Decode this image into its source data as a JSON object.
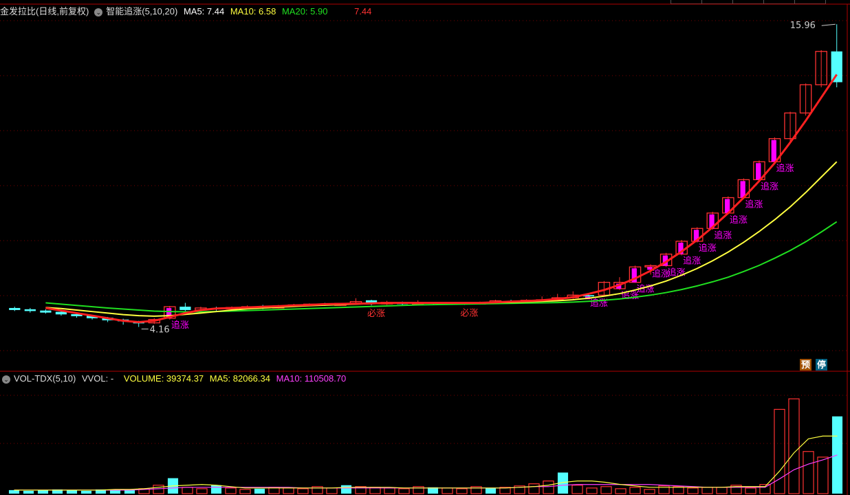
{
  "header_main": {
    "title": "金发拉比(日线,前复权)",
    "indicator": "智能追涨(5,10,20)",
    "ma5": "MA5: 7.44",
    "ma10": "MA10: 6.58",
    "ma20": "MA20: 5.90",
    "extra": "7.44"
  },
  "header_volume": {
    "indicator": "VOL-TDX(5,10)",
    "vvol": "VVOL: -",
    "volume": "VOLUME: 39374.37",
    "ma5": "MA5: 82066.34",
    "ma10": "MA10: 110508.70"
  },
  "annotations": {
    "high_label": "15.96",
    "low_label": "4.16",
    "signal_up": "追涨",
    "signal_must": "必涨"
  },
  "badges": {
    "pre": "预",
    "stop": "停"
  },
  "colors": {
    "ma5": "#ff2020",
    "ma10": "#ffff40",
    "ma20": "#20e020",
    "up": "#ff3232",
    "down": "#54ffff",
    "signal": "#ff00ff",
    "grid": "#7a0000",
    "vol_ma5": "#ffff40",
    "vol_ma10": "#ff40ff"
  },
  "chart_data": {
    "type": "candlestick",
    "price_range": [
      4.16,
      15.96
    ],
    "candles": [
      {
        "o": 4.9,
        "c": 4.82,
        "h": 4.95,
        "l": 4.78
      },
      {
        "o": 4.85,
        "c": 4.78,
        "h": 4.9,
        "l": 4.72
      },
      {
        "o": 4.8,
        "c": 4.72,
        "h": 4.85,
        "l": 4.68
      },
      {
        "o": 4.75,
        "c": 4.65,
        "h": 4.78,
        "l": 4.6
      },
      {
        "o": 4.66,
        "c": 4.58,
        "h": 4.7,
        "l": 4.52
      },
      {
        "o": 4.6,
        "c": 4.5,
        "h": 4.62,
        "l": 4.45
      },
      {
        "o": 4.52,
        "c": 4.42,
        "h": 4.55,
        "l": 4.35
      },
      {
        "o": 4.45,
        "c": 4.38,
        "h": 4.48,
        "l": 4.25
      },
      {
        "o": 4.35,
        "c": 4.3,
        "h": 4.4,
        "l": 4.16
      },
      {
        "o": 4.32,
        "c": 4.45,
        "h": 4.5,
        "l": 4.28
      },
      {
        "o": 4.5,
        "c": 4.95,
        "h": 4.98,
        "l": 4.45
      },
      {
        "o": 4.95,
        "c": 4.82,
        "h": 5.1,
        "l": 4.78
      },
      {
        "o": 4.82,
        "c": 4.9,
        "h": 4.95,
        "l": 4.8
      },
      {
        "o": 4.9,
        "c": 4.85,
        "h": 4.95,
        "l": 4.8
      },
      {
        "o": 4.86,
        "c": 4.92,
        "h": 4.96,
        "l": 4.84
      },
      {
        "o": 4.9,
        "c": 4.95,
        "h": 5.0,
        "l": 4.85
      },
      {
        "o": 4.95,
        "c": 4.9,
        "h": 5.02,
        "l": 4.86
      },
      {
        "o": 4.9,
        "c": 4.98,
        "h": 5.02,
        "l": 4.88
      },
      {
        "o": 4.98,
        "c": 5.02,
        "h": 5.06,
        "l": 4.95
      },
      {
        "o": 5.0,
        "c": 5.05,
        "h": 5.08,
        "l": 4.97
      },
      {
        "o": 5.05,
        "c": 5.0,
        "h": 5.1,
        "l": 4.98
      },
      {
        "o": 5.0,
        "c": 5.08,
        "h": 5.1,
        "l": 4.98
      },
      {
        "o": 5.08,
        "c": 5.15,
        "h": 5.28,
        "l": 5.05
      },
      {
        "o": 5.2,
        "c": 5.05,
        "h": 5.22,
        "l": 5.0
      },
      {
        "o": 5.06,
        "c": 5.12,
        "h": 5.18,
        "l": 5.02
      },
      {
        "o": 5.12,
        "c": 5.05,
        "h": 5.15,
        "l": 5.0
      },
      {
        "o": 5.05,
        "c": 5.1,
        "h": 5.2,
        "l": 5.02
      },
      {
        "o": 5.1,
        "c": 5.08,
        "h": 5.12,
        "l": 5.03
      },
      {
        "o": 5.08,
        "c": 5.1,
        "h": 5.14,
        "l": 5.05
      },
      {
        "o": 5.1,
        "c": 5.05,
        "h": 5.13,
        "l": 5.02
      },
      {
        "o": 5.05,
        "c": 5.12,
        "h": 5.15,
        "l": 5.03
      },
      {
        "o": 5.12,
        "c": 5.18,
        "h": 5.22,
        "l": 5.1
      },
      {
        "o": 5.18,
        "c": 5.16,
        "h": 5.22,
        "l": 5.12
      },
      {
        "o": 5.16,
        "c": 5.2,
        "h": 5.24,
        "l": 5.14
      },
      {
        "o": 5.2,
        "c": 5.22,
        "h": 5.35,
        "l": 5.16
      },
      {
        "o": 5.22,
        "c": 5.3,
        "h": 5.45,
        "l": 5.18
      },
      {
        "o": 5.3,
        "c": 5.4,
        "h": 5.55,
        "l": 5.25
      },
      {
        "o": 5.4,
        "c": 5.35,
        "h": 5.48,
        "l": 5.3
      },
      {
        "o": 5.4,
        "c": 5.9,
        "h": 5.95,
        "l": 5.38
      },
      {
        "o": 5.65,
        "c": 5.9,
        "h": 6.1,
        "l": 5.6
      },
      {
        "o": 5.9,
        "c": 6.5,
        "h": 6.55,
        "l": 5.88
      },
      {
        "o": 6.5,
        "c": 6.55,
        "h": 6.6,
        "l": 6.2
      },
      {
        "o": 6.55,
        "c": 7.0,
        "h": 7.05,
        "l": 6.5
      },
      {
        "o": 7.0,
        "c": 7.5,
        "h": 7.55,
        "l": 6.95
      },
      {
        "o": 7.5,
        "c": 8.0,
        "h": 8.05,
        "l": 7.45
      },
      {
        "o": 8.0,
        "c": 8.6,
        "h": 8.65,
        "l": 7.95
      },
      {
        "o": 8.6,
        "c": 9.2,
        "h": 9.25,
        "l": 8.55
      },
      {
        "o": 9.2,
        "c": 9.9,
        "h": 9.95,
        "l": 9.15
      },
      {
        "o": 9.9,
        "c": 10.6,
        "h": 10.65,
        "l": 9.85
      },
      {
        "o": 10.6,
        "c": 11.5,
        "h": 11.55,
        "l": 10.5
      },
      {
        "o": 11.5,
        "c": 12.5,
        "h": 12.55,
        "l": 11.4
      },
      {
        "o": 12.5,
        "c": 13.6,
        "h": 13.65,
        "l": 12.4
      },
      {
        "o": 13.6,
        "c": 14.9,
        "h": 14.95,
        "l": 13.5
      },
      {
        "o": 14.9,
        "c": 13.7,
        "h": 15.96,
        "l": 13.5
      }
    ],
    "ma5": [
      4.9,
      4.8,
      4.7,
      4.6,
      4.5,
      4.4,
      4.35,
      4.4,
      4.55,
      4.7,
      4.82,
      4.88,
      4.9,
      4.92,
      4.95,
      4.97,
      5.0,
      5.02,
      5.05,
      5.06,
      5.07,
      5.08,
      5.1,
      5.1,
      5.1,
      5.1,
      5.1,
      5.1,
      5.1,
      5.12,
      5.15,
      5.17,
      5.2,
      5.25,
      5.32,
      5.45,
      5.6,
      5.8,
      6.05,
      6.35,
      6.7,
      7.1,
      7.55,
      8.05,
      8.6,
      9.2,
      9.85,
      10.55,
      11.35,
      12.2,
      13.1,
      14.0
    ],
    "ma10": [
      4.92,
      4.88,
      4.82,
      4.76,
      4.7,
      4.64,
      4.6,
      4.58,
      4.6,
      4.65,
      4.7,
      4.76,
      4.82,
      4.87,
      4.9,
      4.93,
      4.96,
      4.99,
      5.01,
      5.03,
      5.05,
      5.07,
      5.08,
      5.09,
      5.1,
      5.1,
      5.1,
      5.1,
      5.1,
      5.11,
      5.12,
      5.14,
      5.16,
      5.18,
      5.22,
      5.28,
      5.36,
      5.46,
      5.6,
      5.76,
      5.95,
      6.18,
      6.44,
      6.74,
      7.08,
      7.46,
      7.88,
      8.34,
      8.84,
      9.4,
      10.0,
      10.6
    ],
    "ma20": [
      5.1,
      5.05,
      5.0,
      4.95,
      4.9,
      4.86,
      4.82,
      4.78,
      4.76,
      4.75,
      4.75,
      4.76,
      4.78,
      4.8,
      4.82,
      4.84,
      4.86,
      4.88,
      4.9,
      4.92,
      4.94,
      4.96,
      4.98,
      5.0,
      5.02,
      5.03,
      5.04,
      5.05,
      5.06,
      5.07,
      5.08,
      5.09,
      5.1,
      5.11,
      5.13,
      5.16,
      5.2,
      5.25,
      5.32,
      5.4,
      5.5,
      5.62,
      5.76,
      5.92,
      6.1,
      6.32,
      6.56,
      6.84,
      7.14,
      7.48,
      7.86,
      8.26
    ],
    "signals_up": [
      10,
      37,
      39,
      40,
      41,
      42,
      43,
      44,
      45,
      46,
      47,
      48,
      49
    ],
    "signals_must": [
      23,
      29
    ],
    "volume": [
      5,
      4,
      5,
      6,
      5,
      4,
      6,
      5,
      5,
      7,
      12,
      22,
      9,
      7,
      12,
      8,
      6,
      7,
      9,
      8,
      7,
      10,
      8,
      12,
      10,
      9,
      8,
      7,
      10,
      9,
      8,
      7,
      10,
      8,
      9,
      11,
      14,
      18,
      30,
      12,
      8,
      10,
      7,
      9,
      6,
      11,
      10,
      8,
      9,
      9,
      12,
      8,
      13,
      120,
      135,
      60,
      52,
      110
    ],
    "volume_up": [
      false,
      false,
      false,
      false,
      false,
      false,
      false,
      false,
      false,
      true,
      true,
      false,
      true,
      true,
      false,
      true,
      true,
      false,
      true,
      true,
      true,
      true,
      true,
      false,
      true,
      true,
      true,
      true,
      true,
      false,
      true,
      true,
      true,
      false,
      true,
      true,
      true,
      true,
      false,
      true,
      true,
      true,
      true,
      true,
      true,
      true,
      true,
      true,
      true,
      true,
      true,
      true,
      true,
      true,
      true,
      true,
      true,
      false
    ],
    "vol_ma5": [
      5,
      5,
      5,
      5,
      5,
      5,
      5,
      6,
      6,
      7,
      9,
      11,
      12,
      13,
      12,
      10,
      8,
      8,
      8,
      8,
      8,
      8,
      8,
      9,
      9,
      9,
      9,
      8,
      8,
      8,
      8,
      8,
      8,
      8,
      8,
      9,
      10,
      12,
      16,
      18,
      18,
      16,
      13,
      11,
      9,
      9,
      9,
      9,
      9,
      9,
      10,
      10,
      10,
      32,
      58,
      78,
      82,
      82
    ],
    "vol_ma10": [
      5,
      5,
      5,
      5,
      5,
      5,
      5,
      5,
      5,
      6,
      7,
      8,
      9,
      9,
      9,
      9,
      9,
      9,
      9,
      9,
      8,
      8,
      8,
      8,
      8,
      8,
      8,
      8,
      8,
      8,
      8,
      8,
      8,
      8,
      8,
      9,
      10,
      10,
      12,
      13,
      13,
      13,
      13,
      13,
      13,
      12,
      11,
      10,
      9,
      9,
      9,
      9,
      9,
      21,
      34,
      42,
      48,
      55
    ],
    "volume_range": [
      0,
      140
    ]
  }
}
